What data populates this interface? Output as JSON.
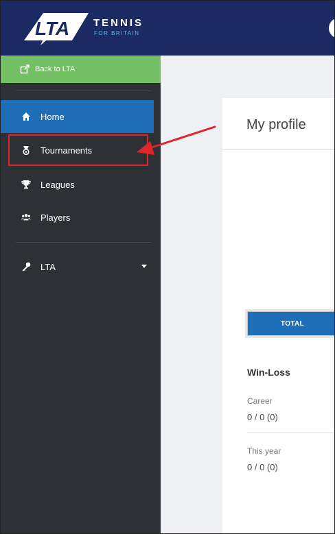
{
  "header": {
    "logo_text": "LTA",
    "brand_title": "TENNIS",
    "brand_subtitle": "FOR BRITAIN",
    "logo_icon": "lta-logo-icon",
    "user_icon": "user-avatar-icon"
  },
  "sidebar": {
    "back_link": {
      "label": "Back to LTA",
      "icon": "external-link-icon"
    },
    "items": [
      {
        "label": "Home",
        "icon": "home-icon",
        "active": true
      },
      {
        "label": "Tournaments",
        "icon": "medal-icon",
        "highlighted": true
      },
      {
        "label": "Leagues",
        "icon": "trophy-icon"
      },
      {
        "label": "Players",
        "icon": "players-icon"
      }
    ],
    "secondary": {
      "label": "LTA",
      "icon": "key-icon",
      "expandable": true
    }
  },
  "main": {
    "title": "My profile",
    "total_button": "TOTAL",
    "win_loss": {
      "title": "Win-Loss",
      "career_label": "Career",
      "career_value": "0 / 0 (0)",
      "this_year_label": "This year",
      "this_year_value": "0 / 0 (0)"
    }
  },
  "colors": {
    "header_bg": "#1b2a63",
    "sidebar_bg": "#2d3135",
    "back_link_bg": "#74bf63",
    "active_bg": "#1f6fb8",
    "highlight_border": "#e0262a",
    "annotation_arrow": "#e0262a"
  }
}
